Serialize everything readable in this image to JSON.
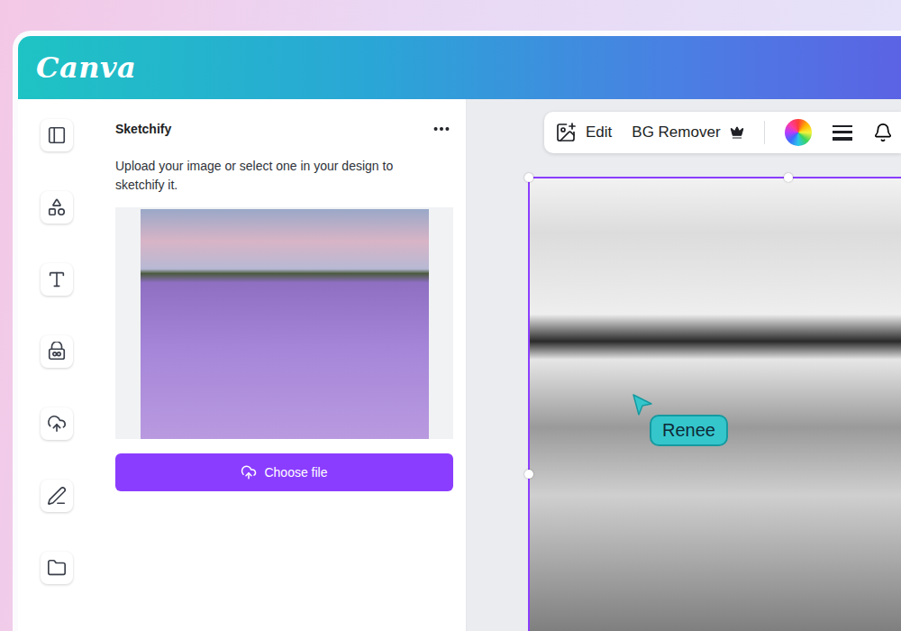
{
  "app": {
    "logo": "Canva"
  },
  "panel": {
    "title": "Sketchify",
    "description": "Upload your image or select one in your design to sketchify it.",
    "button": "Choose file"
  },
  "toolbar": {
    "items": [
      {
        "label": "Edit",
        "premium": false
      },
      {
        "label": "BG Remover",
        "premium": true
      }
    ]
  },
  "cursor": {
    "name": "Renee"
  }
}
